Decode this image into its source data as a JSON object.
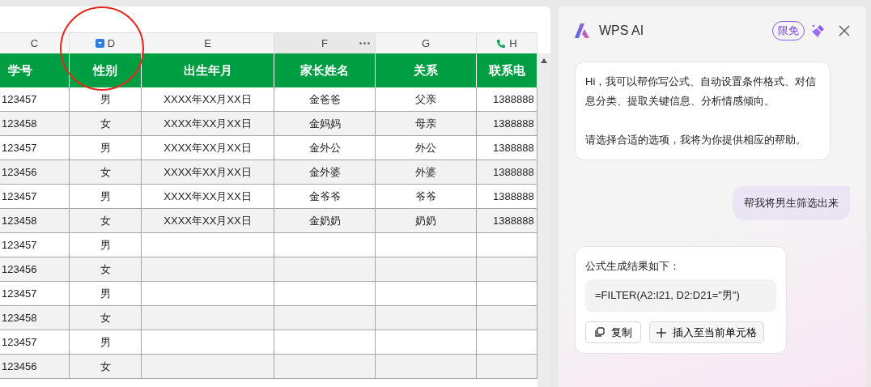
{
  "sheet": {
    "column_letters": [
      {
        "label": "C",
        "selected": false,
        "kind": "plain"
      },
      {
        "label": "D",
        "selected": false,
        "kind": "filter"
      },
      {
        "label": "E",
        "selected": false,
        "kind": "plain"
      },
      {
        "label": "F",
        "selected": true,
        "kind": "plain"
      },
      {
        "label": "G",
        "selected": false,
        "kind": "plain"
      },
      {
        "label": "H",
        "selected": false,
        "kind": "phone"
      }
    ],
    "header": [
      "学号",
      "性别",
      "出生年月",
      "家长姓名",
      "关系",
      "联系电"
    ],
    "rows": [
      {
        "cells": [
          "123457",
          "男",
          "XXXX年XX月XX日",
          "金爸爸",
          "父亲",
          "1388888"
        ]
      },
      {
        "cells": [
          "123458",
          "女",
          "XXXX年XX月XX日",
          "金妈妈",
          "母亲",
          "1388888"
        ]
      },
      {
        "cells": [
          "123457",
          "男",
          "XXXX年XX月XX日",
          "金外公",
          "外公",
          "1388888"
        ]
      },
      {
        "cells": [
          "123456",
          "女",
          "XXXX年XX月XX日",
          "金外婆",
          "外婆",
          "1388888"
        ]
      },
      {
        "cells": [
          "123457",
          "男",
          "XXXX年XX月XX日",
          "金爷爷",
          "爷爷",
          "1388888"
        ]
      },
      {
        "cells": [
          "123458",
          "女",
          "XXXX年XX月XX日",
          "金奶奶",
          "奶奶",
          "1388888"
        ]
      },
      {
        "cells": [
          "123457",
          "男"
        ]
      },
      {
        "cells": [
          "123456",
          "女"
        ]
      },
      {
        "cells": [
          "123457",
          "男"
        ]
      },
      {
        "cells": [
          "123458",
          "女"
        ]
      },
      {
        "cells": [
          "123457",
          "男"
        ]
      },
      {
        "cells": [
          "123456",
          "女"
        ]
      }
    ],
    "annotation": {
      "kind": "circle"
    }
  },
  "ai_panel": {
    "title": "WPS AI",
    "badge": "限免",
    "messages": [
      {
        "kind": "assistant",
        "paragraphs": [
          "Hi，我可以帮你写公式、自动设置条件格式、对信息分类、提取关键信息、分析情感倾向。",
          "请选择合适的选项，我将为你提供相应的帮助。"
        ]
      },
      {
        "kind": "user",
        "text": "帮我将男生筛选出来"
      },
      {
        "kind": "formula",
        "intro": "公式生成结果如下：",
        "formula": "=FILTER(A2:I21, D2:D21=\"男\")",
        "buttons": [
          {
            "label": "复制",
            "kind": "copy"
          },
          {
            "label": "插入至当前单元格",
            "kind": "insert"
          }
        ]
      }
    ]
  }
}
